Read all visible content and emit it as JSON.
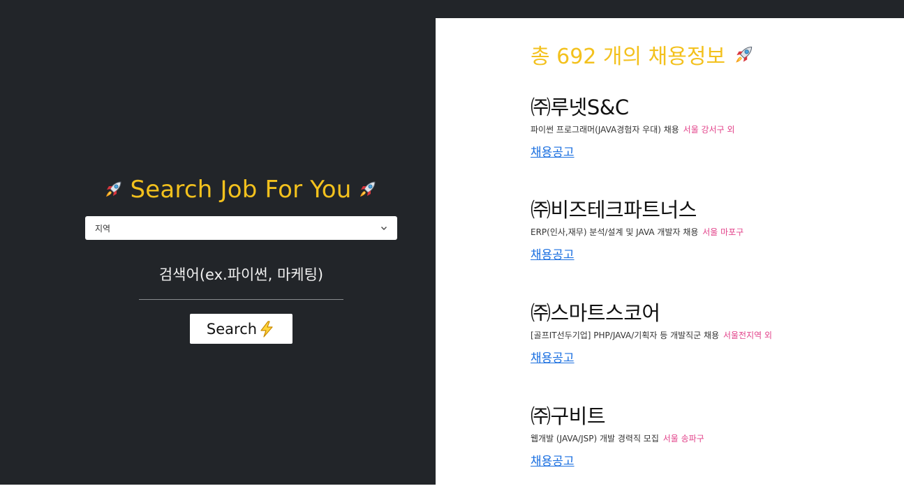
{
  "search_panel": {
    "title": "Search Job For You",
    "region_select": {
      "selected": "지역"
    },
    "keyword_input": {
      "placeholder": "검색어(ex.파이썬, 마케팅)"
    },
    "search_button": {
      "label": "Search"
    }
  },
  "results": {
    "title": "총 692 개의 채용정보",
    "jobs": [
      {
        "company": "㈜루넷S&C",
        "description": "파이썬 프로그래머(JAVA경험자 우대) 채용",
        "location": "서울 강서구 외",
        "link_label": "채용공고"
      },
      {
        "company": "㈜비즈테크파트너스",
        "description": "ERP(인사,재무) 분석/설계 및 JAVA 개발자 채용",
        "location": "서울 마포구",
        "link_label": "채용공고"
      },
      {
        "company": "㈜스마트스코어",
        "description": "[골프IT선두기업] PHP/JAVA/기획자 등 개발직군 채용",
        "location": "서울전지역 외",
        "link_label": "채용공고"
      },
      {
        "company": "㈜구비트",
        "description": "웹개발 (JAVA/JSP) 개발 경력직 모집",
        "location": "서울 송파구",
        "link_label": "채용공고"
      }
    ]
  },
  "colors": {
    "dark_bg": "#222529",
    "accent_yellow": "#f3c11d",
    "location_pink": "#e2428a",
    "link_blue": "#1a6fe0"
  },
  "icons": {
    "title_left": "rocket-icon",
    "title_right": "rocket-icon",
    "results_title": "rocket-icon",
    "search_button": "lightning-icon",
    "select": "chevron-down-icon"
  }
}
